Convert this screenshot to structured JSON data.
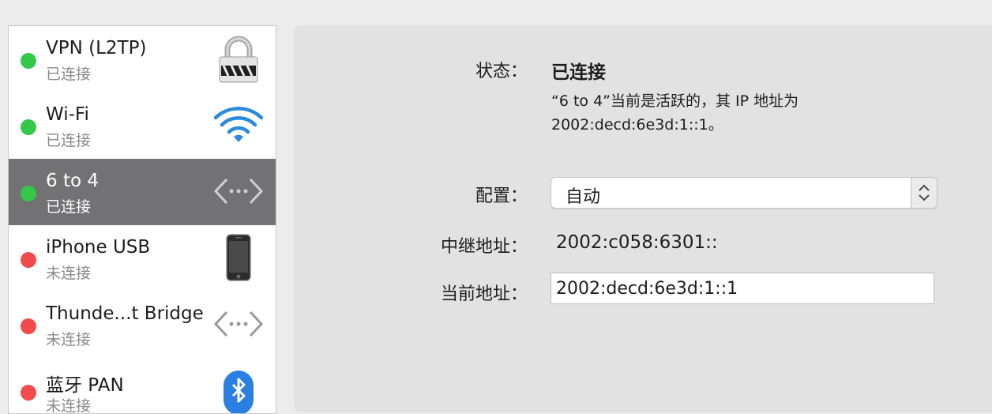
{
  "services": [
    {
      "name": "VPN (L2TP)",
      "status": "已连接",
      "state": "connected",
      "icon": "lock-icon"
    },
    {
      "name": "Wi-Fi",
      "status": "已连接",
      "state": "connected",
      "icon": "wifi-icon"
    },
    {
      "name": "6 to 4",
      "status": "已连接",
      "state": "connected",
      "icon": "tunnel-arrows-icon",
      "selected": true
    },
    {
      "name": "iPhone USB",
      "status": "未连接",
      "state": "disconnected",
      "icon": "iphone-icon"
    },
    {
      "name": "Thunde...t Bridge",
      "status": "未连接",
      "state": "disconnected",
      "icon": "bridge-arrows-icon"
    },
    {
      "name": "蓝牙 PAN",
      "status": "未连接",
      "state": "disconnected",
      "icon": "bluetooth-icon"
    }
  ],
  "colors": {
    "connected": "#34c84a",
    "disconnected": "#f24b4b",
    "selected_row": "#727274"
  },
  "detail": {
    "status_label": "状态：",
    "status_value": "已连接",
    "status_desc_line1": "“6 to 4”当前是活跃的，其 IP 地址为",
    "status_desc_line2": "2002:decd:6e3d:1::1。",
    "config_label": "配置：",
    "config_value": "自动",
    "relay_label": "中继地址：",
    "relay_value": "2002:c058:6301::",
    "current_label": "当前地址：",
    "current_value": "2002:decd:6e3d:1::1"
  }
}
